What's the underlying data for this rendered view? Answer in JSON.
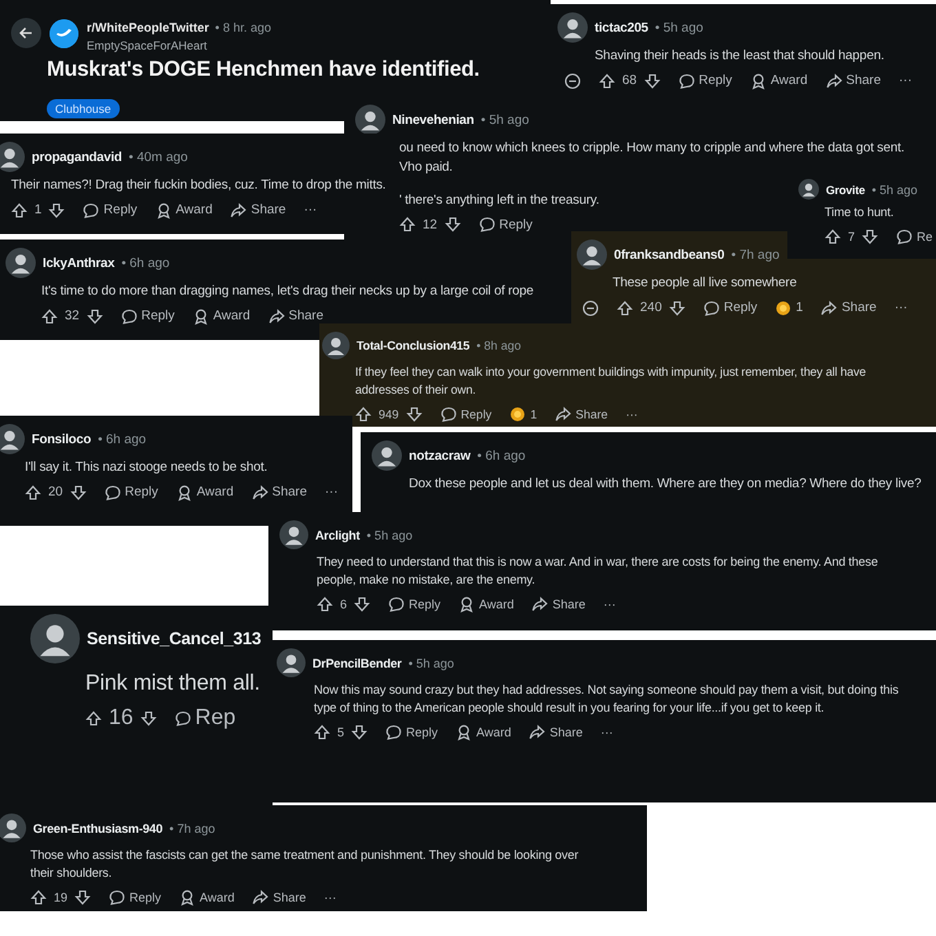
{
  "post": {
    "subreddit": "r/WhitePeopleTwitter",
    "time": "• 8 hr. ago",
    "author": "EmptySpaceForAHeart",
    "title": "Muskrat's DOGE Henchmen have identified.",
    "flair": "Clubhouse"
  },
  "comments": [
    {
      "author": "tictac205",
      "time": "• 5h ago",
      "text": "Shaving their heads is the least that should happen.",
      "votes": "68",
      "highlighted": false,
      "collapsible": true,
      "actions": [
        {
          "kind": "reply",
          "label": "Reply"
        },
        {
          "kind": "award",
          "label": "Award"
        },
        {
          "kind": "share",
          "label": "Share"
        },
        {
          "kind": "more",
          "label": "···"
        }
      ]
    },
    {
      "author": "Ninevehenian",
      "time": "• 5h ago",
      "text": "ou need to know which knees to cripple. How many to cripple and where the data got sent.\nVho paid.\n\n' there's anything left in the treasury.",
      "votes": "12",
      "highlighted": false,
      "collapsible": false,
      "actions": [
        {
          "kind": "reply",
          "label": "Reply"
        }
      ]
    },
    {
      "author": "propagandavid",
      "time": "• 40m ago",
      "text": "Their names?! Drag their fuckin bodies, cuz. Time to drop the mitts.",
      "votes": "1",
      "highlighted": false,
      "collapsible": false,
      "actions": [
        {
          "kind": "reply",
          "label": "Reply"
        },
        {
          "kind": "award",
          "label": "Award"
        },
        {
          "kind": "share",
          "label": "Share"
        },
        {
          "kind": "more",
          "label": "···"
        }
      ]
    },
    {
      "author": "Grovite",
      "time": "• 5h ago",
      "text": "Time to hunt.",
      "votes": "7",
      "highlighted": false,
      "collapsible": false,
      "actions": [
        {
          "kind": "reply",
          "label": "Re"
        }
      ]
    },
    {
      "author": "IckyAnthrax",
      "time": "• 6h ago",
      "text": "It's time to do more than dragging names, let's drag their necks up by a large coil of rope",
      "votes": "32",
      "highlighted": false,
      "collapsible": false,
      "actions": [
        {
          "kind": "reply",
          "label": "Reply"
        },
        {
          "kind": "award",
          "label": "Award"
        },
        {
          "kind": "share",
          "label": "Share"
        }
      ]
    },
    {
      "author": "0franksandbeans0",
      "time": "• 7h ago",
      "text": "These people all live somewhere",
      "votes": "240",
      "highlighted": true,
      "collapsible": true,
      "actions": [
        {
          "kind": "reply",
          "label": "Reply"
        },
        {
          "kind": "gift",
          "label": "1"
        },
        {
          "kind": "share",
          "label": "Share"
        },
        {
          "kind": "more",
          "label": "···"
        }
      ]
    },
    {
      "author": "Total-Conclusion415",
      "time": "• 8h ago",
      "text": "If they feel they can walk into your government buildings with impunity, just remember, they all have\naddresses of their own.",
      "votes": "949",
      "highlighted": true,
      "collapsible": false,
      "actions": [
        {
          "kind": "reply",
          "label": "Reply"
        },
        {
          "kind": "gift",
          "label": "1"
        },
        {
          "kind": "share",
          "label": "Share"
        },
        {
          "kind": "more",
          "label": "···"
        }
      ]
    },
    {
      "author": "Fonsiloco",
      "time": "• 6h ago",
      "text": "I'll say it. This nazi stooge needs to be shot.",
      "votes": "20",
      "highlighted": false,
      "collapsible": false,
      "actions": [
        {
          "kind": "reply",
          "label": "Reply"
        },
        {
          "kind": "award",
          "label": "Award"
        },
        {
          "kind": "share",
          "label": "Share"
        },
        {
          "kind": "more",
          "label": "···"
        }
      ]
    },
    {
      "author": "notzacraw",
      "time": "• 6h ago",
      "text": "Dox these people and let us deal with them. Where are they on media? Where do they live?",
      "highlighted": false,
      "collapsible": false
    },
    {
      "author": "Arclight",
      "time": "• 5h ago",
      "text": "They need to understand that this is now a war. And in war, there are costs for being the enemy. And these\npeople, make no mistake, are the enemy.",
      "votes": "6",
      "highlighted": false,
      "collapsible": false,
      "actions": [
        {
          "kind": "reply",
          "label": "Reply"
        },
        {
          "kind": "award",
          "label": "Award"
        },
        {
          "kind": "share",
          "label": "Share"
        },
        {
          "kind": "more",
          "label": "···"
        }
      ]
    },
    {
      "author": "Sensitive_Cancel_313",
      "text": "Pink mist them all.",
      "votes": "16",
      "highlighted": false,
      "collapsible": false,
      "actions": [
        {
          "kind": "reply",
          "label": "Rep"
        }
      ]
    },
    {
      "author": "DrPencilBender",
      "time": "• 5h ago",
      "text": "Now this may sound crazy but they had addresses. Not saying someone should pay them a visit, but doing this\ntype of thing to the American people should result in you fearing for your life...if you get to keep it.",
      "votes": "5",
      "highlighted": false,
      "collapsible": false,
      "actions": [
        {
          "kind": "reply",
          "label": "Reply"
        },
        {
          "kind": "award",
          "label": "Award"
        },
        {
          "kind": "share",
          "label": "Share"
        },
        {
          "kind": "more",
          "label": "···"
        }
      ]
    },
    {
      "author": "Green-Enthusiasm-940",
      "time": "• 7h ago",
      "text": "Those who assist the fascists can get the same treatment and punishment. They should be looking over\ntheir shoulders.",
      "votes": "19",
      "highlighted": false,
      "collapsible": false,
      "actions": [
        {
          "kind": "reply",
          "label": "Reply"
        },
        {
          "kind": "award",
          "label": "Award"
        },
        {
          "kind": "share",
          "label": "Share"
        },
        {
          "kind": "more",
          "label": "···"
        }
      ]
    }
  ]
}
